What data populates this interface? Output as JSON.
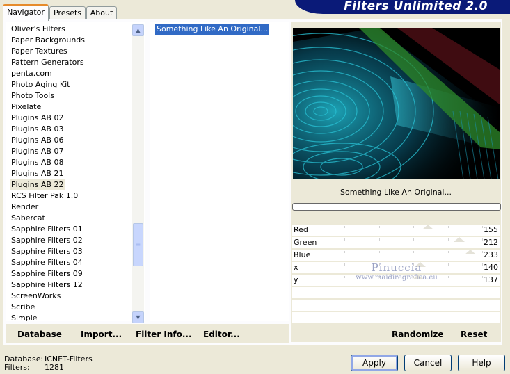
{
  "app_title": "Filters Unlimited 2.0",
  "tabs": [
    {
      "label": "Navigator",
      "active": true
    },
    {
      "label": "Presets",
      "active": false
    },
    {
      "label": "About",
      "active": false
    }
  ],
  "categories": [
    "Oliver's Filters",
    "Paper Backgrounds",
    "Paper Textures",
    "Pattern Generators",
    "penta.com",
    "Photo Aging Kit",
    "Photo Tools",
    "Pixelate",
    "Plugins AB 02",
    "Plugins AB 03",
    "Plugins AB 06",
    "Plugins AB 07",
    "Plugins AB 08",
    "Plugins AB 21",
    "Plugins AB 22",
    "RCS Filter Pak 1.0",
    "Render",
    "Sabercat",
    "Sapphire Filters 01",
    "Sapphire Filters 02",
    "Sapphire Filters 03",
    "Sapphire Filters 04",
    "Sapphire Filters 09",
    "Sapphire Filters 12",
    "ScreenWorks",
    "Scribe",
    "Simple"
  ],
  "selected_category": "Plugins AB 22",
  "filters": [
    "Something Like An Original..."
  ],
  "left_buttons": {
    "database": "Database",
    "import": "Import...",
    "filter_info": "Filter Info...",
    "editor": "Editor..."
  },
  "preview_filter_name": "Something Like An Original...",
  "progress": 0,
  "params": [
    {
      "label": "Red",
      "value": "155",
      "level": 0.608
    },
    {
      "label": "Green",
      "value": "212",
      "level": 0.831
    },
    {
      "label": "Blue",
      "value": "233",
      "level": 0.914
    },
    {
      "label": "x",
      "value": "140",
      "level": 0.549
    },
    {
      "label": "y",
      "value": "137",
      "level": 0.537
    }
  ],
  "watermark": {
    "line1": "Pinuccia",
    "line2": "www.maidiregrafica.eu"
  },
  "right_buttons": {
    "randomize": "Randomize",
    "reset": "Reset"
  },
  "status": {
    "database_label": "Database:",
    "database_value": "ICNET-Filters",
    "filters_label": "Filters:",
    "filters_value": "1281"
  },
  "dialog_buttons": {
    "apply": "Apply",
    "cancel": "Cancel",
    "help": "Help"
  },
  "colors": {
    "banner": "#0a1a78",
    "selection": "#316ac5",
    "tab_accent": "#e68b2c"
  }
}
